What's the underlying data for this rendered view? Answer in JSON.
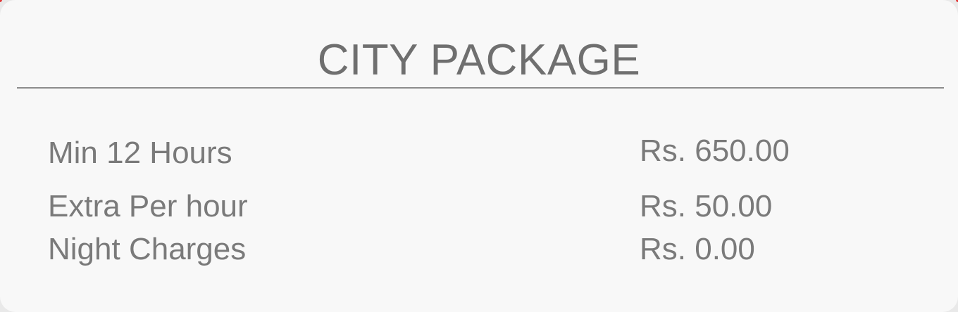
{
  "package": {
    "title": "CITY PACKAGE",
    "rows": [
      {
        "label": "Min 12 Hours",
        "value": "Rs. 650.00"
      },
      {
        "label": "Extra Per hour",
        "value": "Rs. 50.00"
      },
      {
        "label": "Night Charges",
        "value": "Rs. 0.00"
      }
    ]
  },
  "colors": {
    "card_background": "#f8f8f8",
    "text": "#737373",
    "divider": "#8c8c8c",
    "accent": "#e23a3a"
  }
}
